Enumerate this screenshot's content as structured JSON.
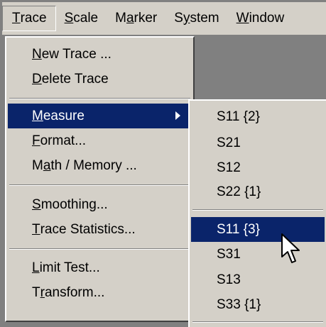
{
  "menubar": {
    "items": [
      {
        "first": "T",
        "rest": "race"
      },
      {
        "first": "S",
        "rest": "cale"
      },
      {
        "pre": "M",
        "first": "a",
        "rest": "rker"
      },
      {
        "pre": "S",
        "first": "y",
        "rest": "stem"
      },
      {
        "first": "W",
        "rest": "indow"
      }
    ]
  },
  "trace_menu": {
    "new_trace": {
      "first": "N",
      "rest": "ew Trace ..."
    },
    "delete_trace": {
      "first": "D",
      "rest": "elete Trace"
    },
    "measure": {
      "first": "M",
      "rest": "easure"
    },
    "format": {
      "first": "F",
      "rest": "ormat..."
    },
    "math_memory": {
      "pre": "M",
      "first": "a",
      "rest": "th / Memory ..."
    },
    "smoothing": {
      "first": "S",
      "rest": "moothing..."
    },
    "trace_statistics": {
      "first": "T",
      "rest": "race Statistics..."
    },
    "limit_test": {
      "first": "L",
      "rest": "imit Test..."
    },
    "transform": {
      "pre": "T",
      "first": "r",
      "rest": "ansform..."
    }
  },
  "measure_submenu": {
    "items": [
      "S11 {2}",
      "S21",
      "S12",
      "S22 {1}",
      "S11 {3}",
      "S31",
      "S13",
      "S33 {1}"
    ],
    "selected": "S11 {3}"
  },
  "colors": {
    "menu_bg": "#d4d0c8",
    "highlight": "#0a246a",
    "highlight_text": "#ffffff"
  }
}
